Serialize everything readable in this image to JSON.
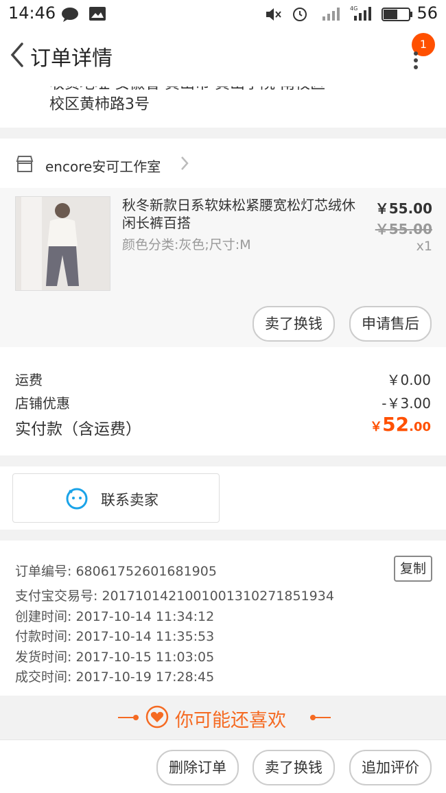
{
  "status_bar": {
    "time": "14:46",
    "battery": "56"
  },
  "header": {
    "title": "订单详情",
    "badge_count": "1"
  },
  "address": {
    "line1": "收货地址 安徽省 黄山市 黄山学院 南校区",
    "line2": "校区黄柿路3号"
  },
  "shop": {
    "name": "encore安可工作室"
  },
  "item": {
    "title": "秋冬新款日系软妹松紧腰宽松灯芯绒休闲长裤百搭",
    "sku": "颜色分类:灰色;尺寸:M",
    "price": "￥55.00",
    "original_price": "￥55.00",
    "quantity": "x1",
    "actions": {
      "resell": "卖了换钱",
      "after_sale": "申请售后"
    }
  },
  "fees": {
    "shipping_label": "运费",
    "shipping_value": "￥0.00",
    "discount_label": "店铺优惠",
    "discount_value": "-￥3.00",
    "total_label": "实付款（含运费）",
    "total_currency": "￥",
    "total_int": "52",
    "total_dec": ".00"
  },
  "contact": {
    "label": "联系卖家"
  },
  "order_info": {
    "order_no": "订单编号: 68061752601681905",
    "alipay_no": "支付宝交易号: 2017101421001001310271851934",
    "created": "创建时间: 2017-10-14 11:34:12",
    "paid": "付款时间: 2017-10-14 11:35:53",
    "shipped": "发货时间: 2017-10-15 11:03:05",
    "completed": "成交时间: 2017-10-19 17:28:45",
    "copy_label": "复制"
  },
  "recommend": {
    "title": "你可能还喜欢"
  },
  "bottom_bar": {
    "delete": "删除订单",
    "resell": "卖了换钱",
    "review": "追加评价"
  },
  "colors": {
    "accent": "#ff5000",
    "recommend": "#f56a22",
    "contact_icon": "#1aa3e8"
  }
}
